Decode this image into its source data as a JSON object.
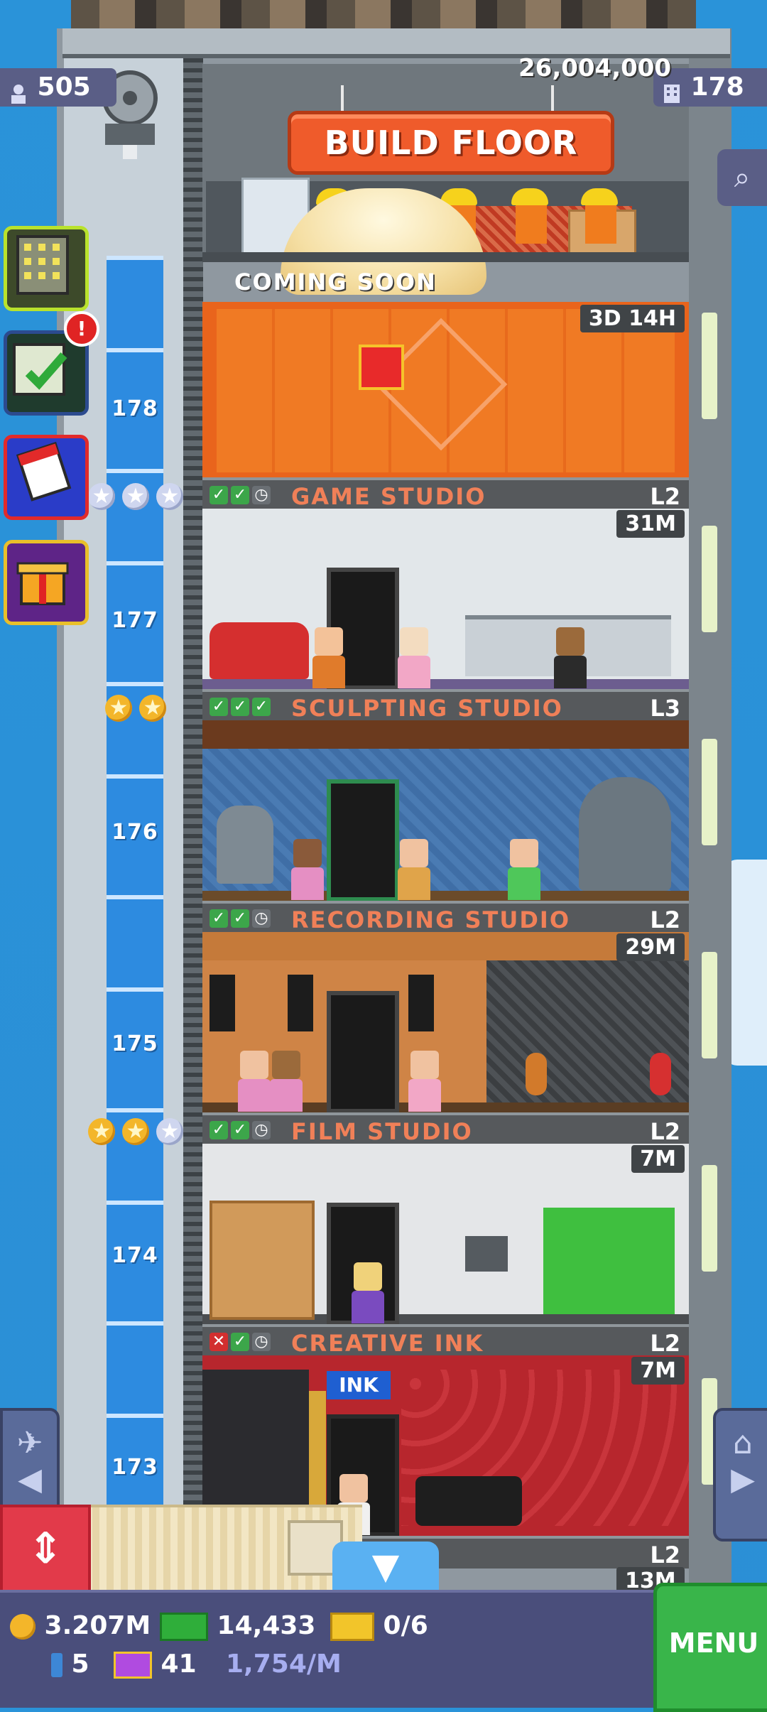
{
  "hud": {
    "population": "505",
    "floors": "178",
    "build_cost": "26,004,000",
    "build_button": "BUILD FLOOR",
    "coming_soon": "COMING SOON"
  },
  "floors": [
    {
      "number": "178",
      "name": "GAME STUDIO",
      "level": "L2",
      "timer_above": "3D 14H",
      "timer": "31M",
      "checks": [
        "ok",
        "ok",
        "clock"
      ],
      "stars": 0
    },
    {
      "number": "177",
      "name": "SCULPTING STUDIO",
      "level": "L3",
      "timer": "",
      "checks": [
        "ok",
        "ok",
        "ok"
      ],
      "stars": 3
    },
    {
      "number": "176",
      "name": "RECORDING STUDIO",
      "level": "L2",
      "timer": "29M",
      "checks": [
        "ok",
        "ok",
        "clock"
      ],
      "stars": 2
    },
    {
      "number": "175",
      "name": "FILM STUDIO",
      "level": "L2",
      "timer": "7M",
      "checks": [
        "ok",
        "ok",
        "clock"
      ],
      "stars": 2
    },
    {
      "number": "174",
      "name": "CREATIVE INK",
      "level": "L2",
      "timer": "7M",
      "checks": [
        "fail",
        "ok",
        "clock"
      ],
      "stars": 0
    },
    {
      "number": "173",
      "name": "",
      "level": "L2",
      "timer": "13M",
      "checks": [],
      "stars": 0
    }
  ],
  "shop_signs": {
    "ink": "INK"
  },
  "bottom_bar": {
    "coins": "3.207M",
    "bux": "14,433",
    "tickets": "0/6",
    "keys": "5",
    "vip": "41",
    "rate": "1,754/M",
    "menu": "MENU"
  },
  "colors": {
    "sky": "#2a93d9",
    "accent_orange": "#ef5b2b",
    "floor_label": "#f08058",
    "menu_green": "#39b54a",
    "bar_bg": "#4a4e7b"
  },
  "icons": {
    "population": "person-icon",
    "floors": "building-icon",
    "search": "magnifier-icon",
    "coins": "coin-icon",
    "bux": "bux-icon",
    "tickets": "ticket-icon",
    "keys": "key-icon",
    "vip": "vip-icon"
  }
}
